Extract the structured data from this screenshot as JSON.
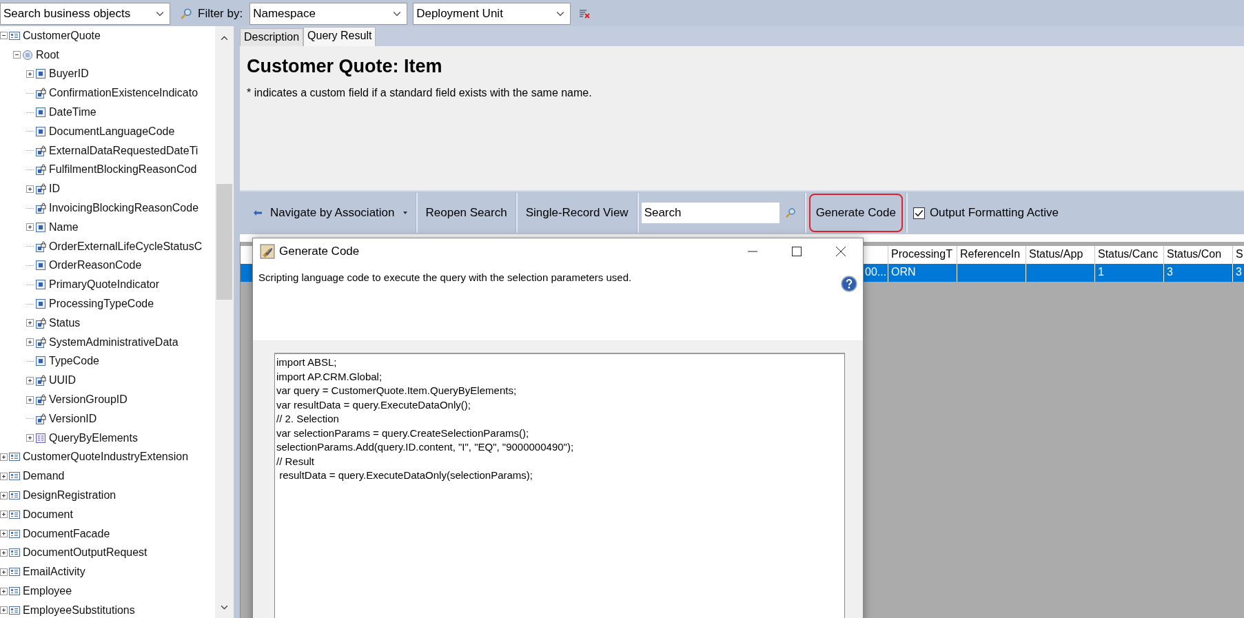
{
  "search_bar": {
    "object_search": "Search business objects",
    "filter_label": "Filter by:",
    "namespace": "Namespace",
    "deployment_unit": "Deployment Unit"
  },
  "tree": [
    {
      "label": "CustomerQuote",
      "kind": "business_object",
      "expanded": true,
      "children": [
        {
          "label": "Root",
          "kind": "node",
          "expanded": true,
          "children": [
            {
              "label": "BuyerID",
              "kind": "element",
              "expanded": false
            },
            {
              "label": "ConfirmationExistenceIndicato",
              "kind": "locked_element"
            },
            {
              "label": "DateTime",
              "kind": "element"
            },
            {
              "label": "DocumentLanguageCode",
              "kind": "element"
            },
            {
              "label": "ExternalDataRequestedDateTi",
              "kind": "locked_element"
            },
            {
              "label": "FulfilmentBlockingReasonCod",
              "kind": "locked_element"
            },
            {
              "label": "ID",
              "kind": "locked_element",
              "expanded": false
            },
            {
              "label": "InvoicingBlockingReasonCode",
              "kind": "locked_element"
            },
            {
              "label": "Name",
              "kind": "element",
              "expanded": false
            },
            {
              "label": "OrderExternalLifeCycleStatusC",
              "kind": "locked_element"
            },
            {
              "label": "OrderReasonCode",
              "kind": "element"
            },
            {
              "label": "PrimaryQuoteIndicator",
              "kind": "element"
            },
            {
              "label": "ProcessingTypeCode",
              "kind": "element"
            },
            {
              "label": "Status",
              "kind": "locked_element",
              "expanded": false
            },
            {
              "label": "SystemAdministrativeData",
              "kind": "locked_element",
              "expanded": false
            },
            {
              "label": "TypeCode",
              "kind": "element"
            },
            {
              "label": "UUID",
              "kind": "locked_element",
              "expanded": false
            },
            {
              "label": "VersionGroupID",
              "kind": "locked_element",
              "expanded": false
            },
            {
              "label": "VersionID",
              "kind": "locked_element"
            },
            {
              "label": "QueryByElements",
              "kind": "query",
              "expanded": false
            }
          ]
        }
      ]
    },
    {
      "label": "CustomerQuoteIndustryExtension",
      "kind": "business_object",
      "expanded": false
    },
    {
      "label": "Demand",
      "kind": "business_object",
      "expanded": false
    },
    {
      "label": "DesignRegistration",
      "kind": "business_object",
      "expanded": false
    },
    {
      "label": "Document",
      "kind": "business_object",
      "expanded": false
    },
    {
      "label": "DocumentFacade",
      "kind": "business_object",
      "expanded": false
    },
    {
      "label": "DocumentOutputRequest",
      "kind": "business_object",
      "expanded": false
    },
    {
      "label": "EmailActivity",
      "kind": "business_object",
      "expanded": false
    },
    {
      "label": "Employee",
      "kind": "business_object",
      "expanded": false
    },
    {
      "label": "EmployeeSubstitutions",
      "kind": "business_object",
      "expanded": false
    }
  ],
  "tabs": [
    {
      "label": "Description",
      "selected": false
    },
    {
      "label": "Query Result",
      "selected": true
    }
  ],
  "header": {
    "title": "Customer Quote: Item",
    "note": "* indicates a custom field if a standard field exists with the same name."
  },
  "toolbar": [
    {
      "kind": "menu",
      "label": "Navigate by Association"
    },
    {
      "kind": "button",
      "label": "Reopen Search"
    },
    {
      "kind": "button",
      "label": "Single-Record View"
    },
    {
      "kind": "search",
      "value": "Search"
    },
    {
      "kind": "button",
      "label": "Generate Code",
      "highlighted": true
    },
    {
      "kind": "checkbox",
      "label": "Output Formatting Active",
      "checked": true
    }
  ],
  "grid": {
    "columns": [
      "",
      "ProcessingT",
      "ReferenceIn",
      "Status/App",
      "Status/Canc",
      "Status/Con",
      "S"
    ],
    "rows": [
      {
        "selected": true,
        "cells": [
          {
            "text": "00..."
          },
          {
            "text": "ORN"
          },
          {
            "text": ""
          },
          {
            "text": ""
          },
          {
            "text": "1"
          },
          {
            "text": "3"
          },
          {
            "text": "3"
          }
        ]
      }
    ]
  },
  "dialog": {
    "title": "Generate Code",
    "description": "Scripting language code to execute the query with the selection parameters used.",
    "code": [
      "import ABSL;",
      "import AP.CRM.Global;",
      "var query = CustomerQuote.Item.QueryByElements;",
      "var resultData = query.ExecuteDataOnly();",
      "// 2. Selection",
      "var selectionParams = query.CreateSelectionParams();",
      "selectionParams.Add(query.ID.content, \"I\", \"EQ\", \"9000000490\");",
      "// Result",
      " resultData = query.ExecuteDataOnly(selectionParams);"
    ]
  }
}
